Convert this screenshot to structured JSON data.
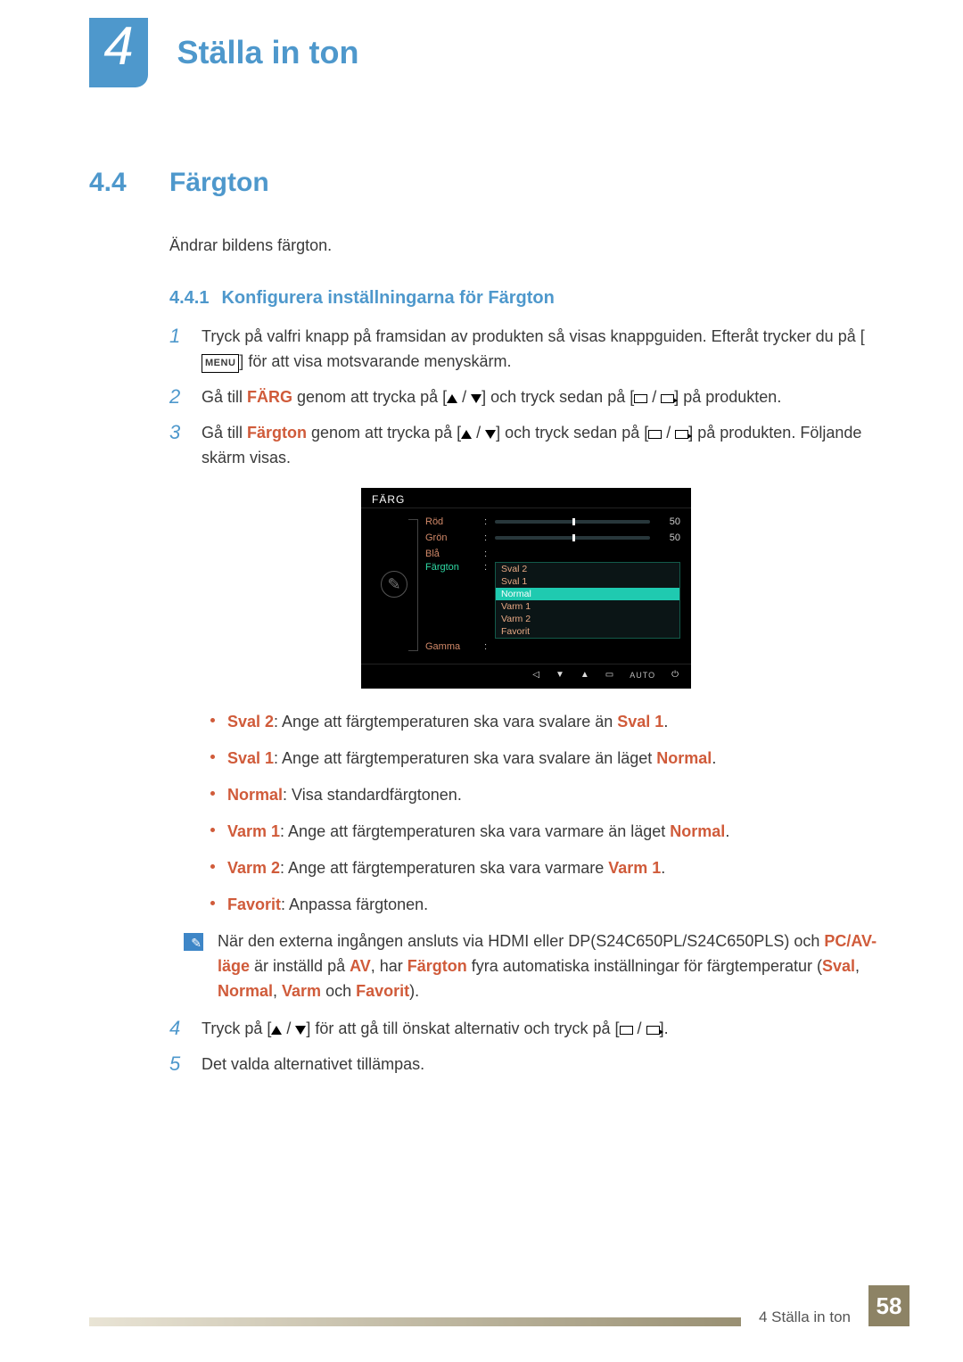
{
  "chapter": {
    "number": "4",
    "title": "Ställa in ton"
  },
  "section": {
    "number": "4.4",
    "title": "Färgton",
    "intro": "Ändrar bildens färgton."
  },
  "subsection": {
    "number": "4.4.1",
    "title": "Konfigurera inställningarna för Färgton"
  },
  "menu_button": "MENU",
  "steps": {
    "s1": {
      "n": "1",
      "pre": "Tryck på valfri knapp på framsidan av produkten så visas knappguiden. Efteråt trycker du på [",
      "post": "] för att visa motsvarande menyskärm."
    },
    "s2": {
      "n": "2",
      "a": "Gå till ",
      "kw": "FÄRG",
      "b": " genom att trycka på [",
      "c": "] och tryck sedan på [",
      "d": "] på produkten."
    },
    "s3": {
      "n": "3",
      "a": "Gå till ",
      "kw": "Färgton",
      "b": " genom att trycka på [",
      "c": "] och tryck sedan på [",
      "d": "] på produkten. Följande skärm visas."
    },
    "s4": {
      "n": "4",
      "a": "Tryck på [",
      "b": "] för att gå till önskat alternativ och tryck på [",
      "c": "]."
    },
    "s5": {
      "n": "5",
      "text": "Det valda alternativet tillämpas."
    }
  },
  "osd": {
    "title": "FÄRG",
    "rows": {
      "red": {
        "label": "Röd",
        "val": "50"
      },
      "green": {
        "label": "Grön",
        "val": "50"
      },
      "blue": {
        "label": "Blå"
      },
      "tone": {
        "label": "Färgton"
      },
      "gamma": {
        "label": "Gamma"
      }
    },
    "dropdown": [
      "Sval 2",
      "Sval 1",
      "Normal",
      "Varm 1",
      "Varm 2",
      "Favorit"
    ],
    "auto": "AUTO"
  },
  "bullets": {
    "b1": {
      "kw": "Sval 2",
      "t": ": Ange att färgtemperaturen ska vara svalare än ",
      "kw2": "Sval 1",
      "tail": "."
    },
    "b2": {
      "kw": "Sval 1",
      "t": ": Ange att färgtemperaturen ska vara svalare än läget ",
      "kw2": "Normal",
      "tail": "."
    },
    "b3": {
      "kw": "Normal",
      "t": ": Visa standardfärgtonen."
    },
    "b4": {
      "kw": "Varm 1",
      "t": ": Ange att färgtemperaturen ska vara varmare än läget ",
      "kw2": "Normal",
      "tail": "."
    },
    "b5": {
      "kw": "Varm 2",
      "t": ": Ange att färgtemperaturen ska vara varmare ",
      "kw2": "Varm 1",
      "tail": "."
    },
    "b6": {
      "kw": "Favorit",
      "t": ": Anpassa färgtonen."
    }
  },
  "note": {
    "a": "När den externa ingången ansluts via HDMI eller DP(S24C650PL/S24C650PLS) och ",
    "kw1": "PC/AV-läge",
    "b": " är inställd på ",
    "kw2": "AV",
    "c": ", har ",
    "kw3": "Färgton",
    "d": " fyra automatiska inställningar för färgtemperatur (",
    "kw4": "Sval",
    "e": ", ",
    "kw5": "Normal",
    "f": ", ",
    "kw6": "Varm",
    "g": " och ",
    "kw7": "Favorit",
    "h": ")."
  },
  "footer": {
    "label": "4 Ställa in ton",
    "page": "58"
  }
}
